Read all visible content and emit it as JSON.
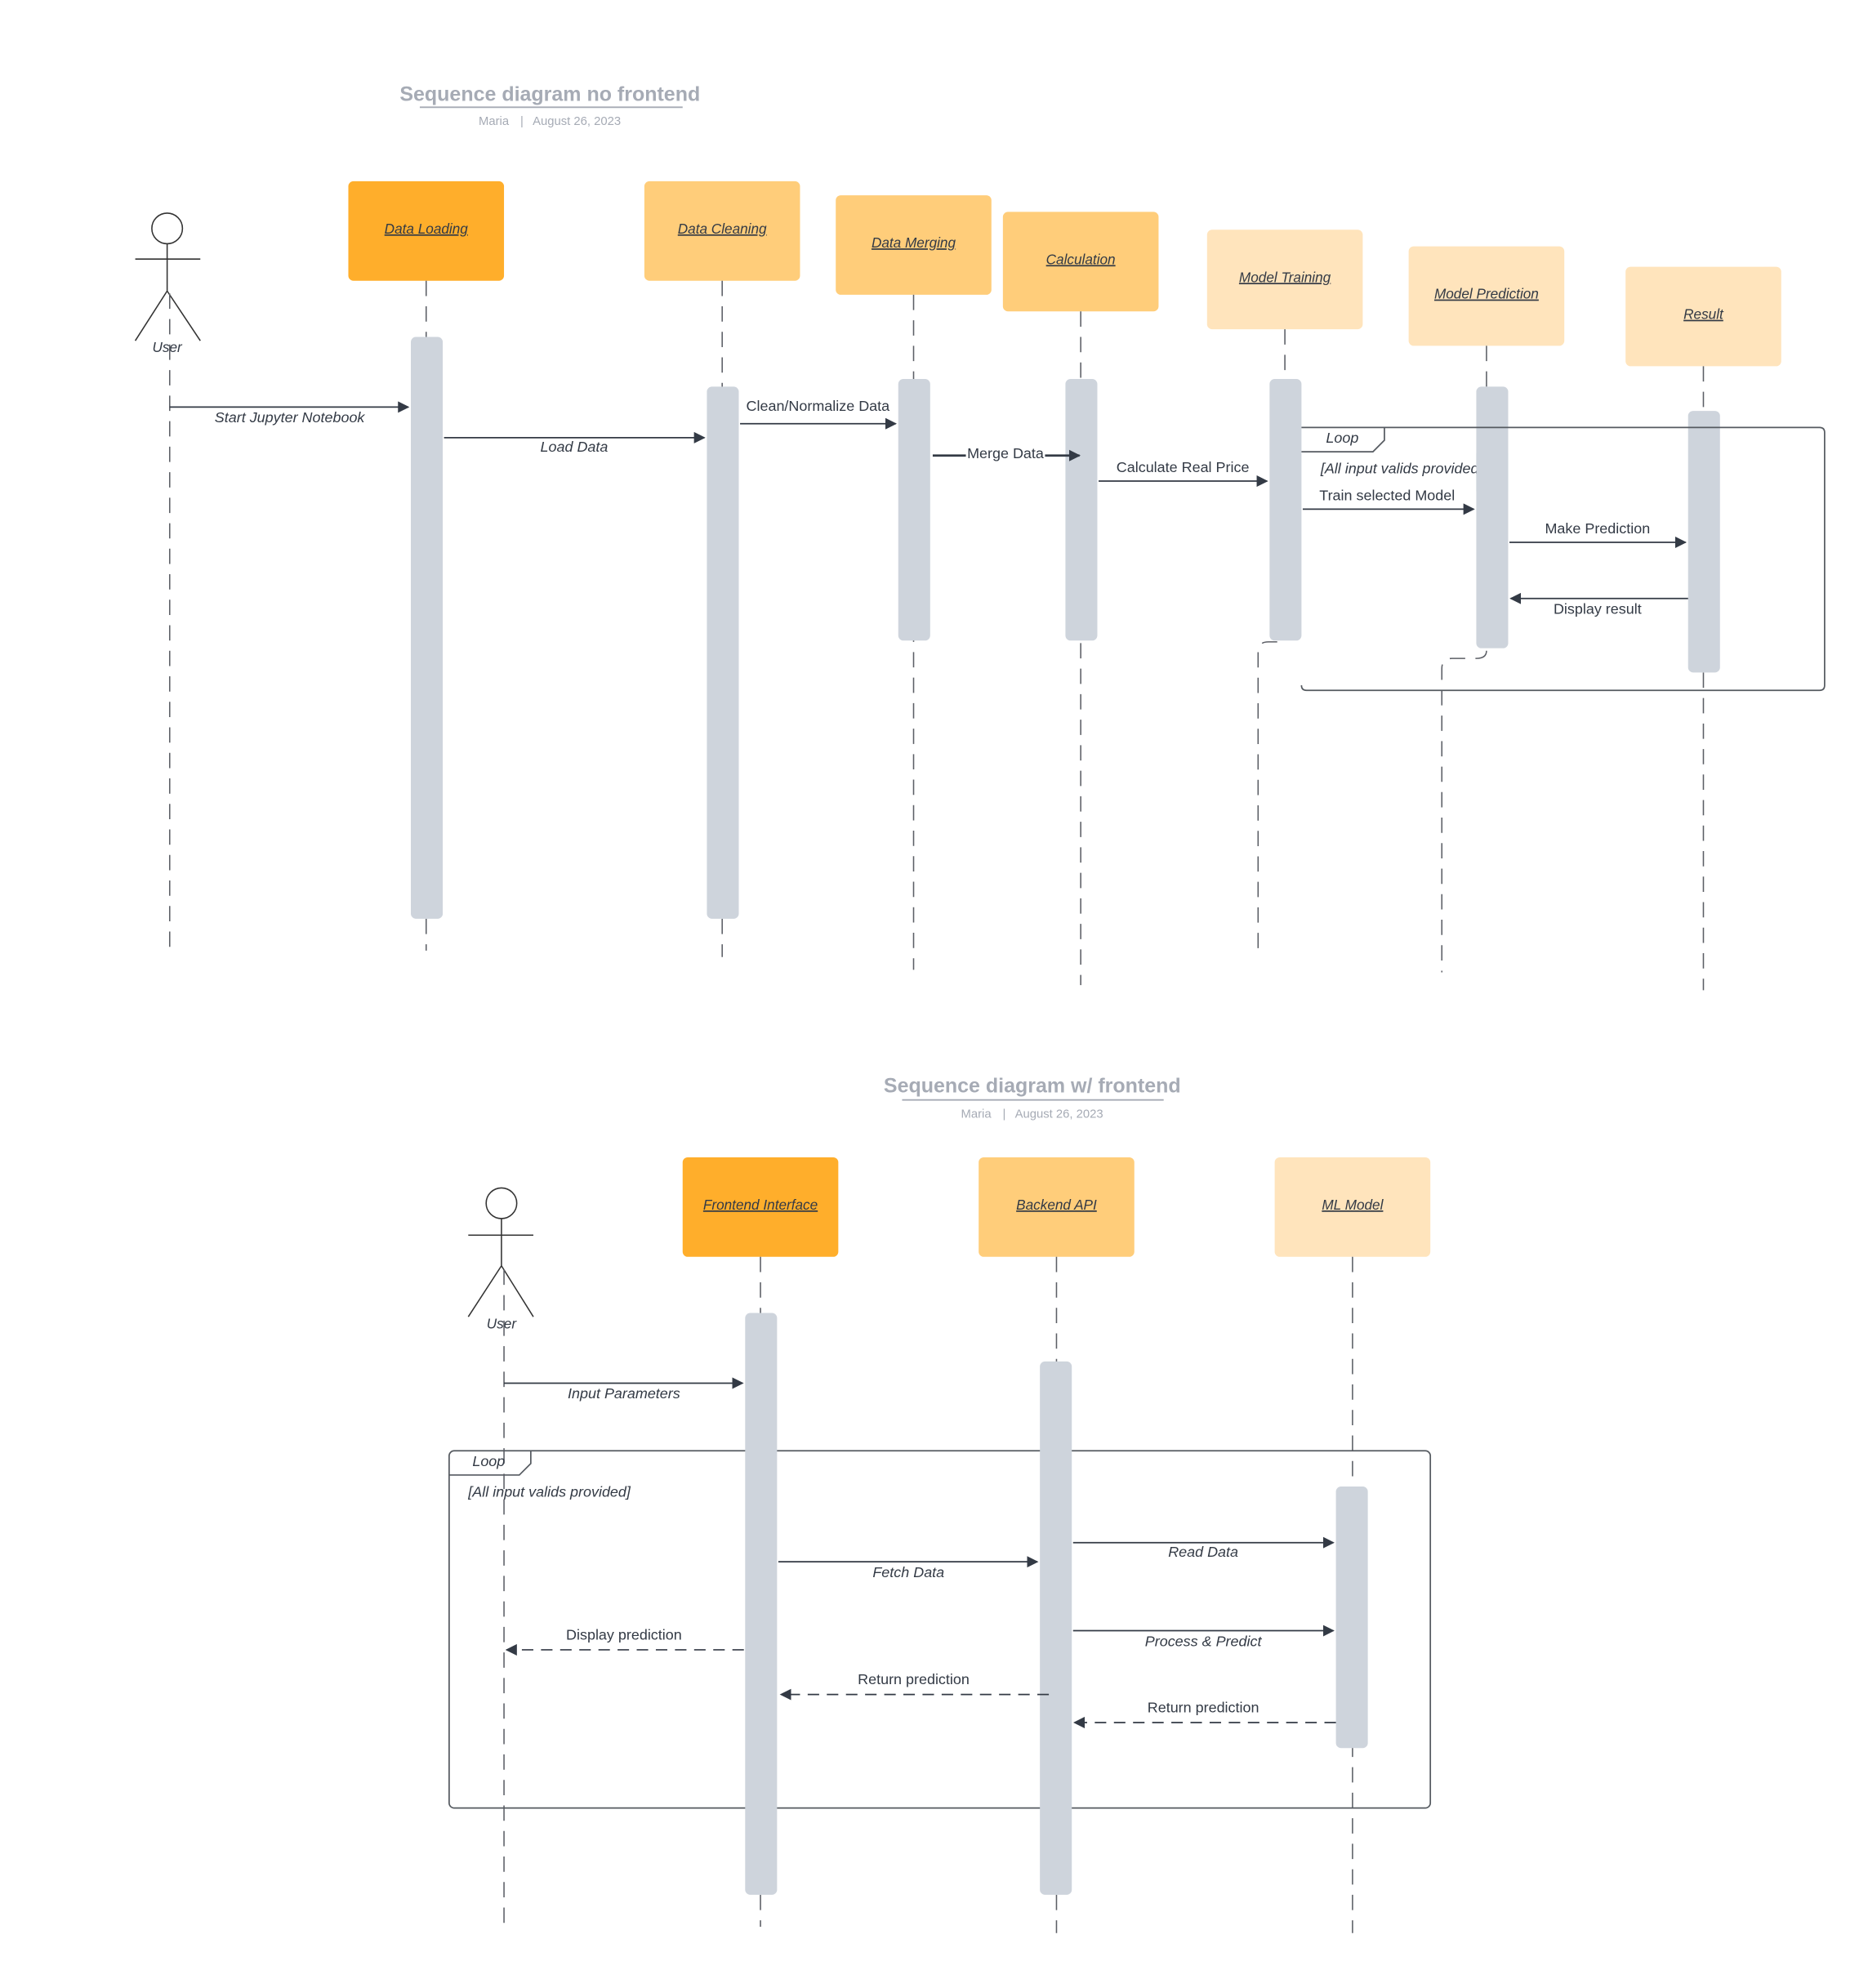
{
  "diagrams": [
    {
      "title": "Sequence diagram no frontend",
      "author": "Maria",
      "separator": "|",
      "date": "August 26, 2023",
      "actor": "User",
      "participants": [
        {
          "label": "Data Loading",
          "color": "#ffae2b"
        },
        {
          "label": "Data Cleaning",
          "color": "#ffcd7a"
        },
        {
          "label": "Data Merging",
          "color": "#ffcd7a"
        },
        {
          "label": "Calculation",
          "color": "#ffcd7a"
        },
        {
          "label": "Model Training",
          "color": "#ffe4bc"
        },
        {
          "label": "Model Prediction",
          "color": "#ffe4bc"
        },
        {
          "label": "Result",
          "color": "#ffe4bc"
        }
      ],
      "messages": [
        {
          "from": "User",
          "to": "Data Loading",
          "label": "Start Jupyter Notebook",
          "style": "solid"
        },
        {
          "from": "Data Loading",
          "to": "Data Cleaning",
          "label": "Load Data",
          "style": "solid"
        },
        {
          "from": "Data Cleaning",
          "to": "Data Merging",
          "label": "Clean/Normalize Data",
          "style": "solid"
        },
        {
          "from": "Data Merging",
          "to": "Calculation",
          "label": "Merge Data",
          "style": "solid"
        },
        {
          "from": "Calculation",
          "to": "Model Training",
          "label": "Calculate Real Price",
          "style": "solid"
        },
        {
          "from": "Model Training",
          "to": "Model Prediction",
          "label": "Train selected Model",
          "style": "solid"
        },
        {
          "from": "Model Prediction",
          "to": "Result",
          "label": "Make Prediction",
          "style": "solid"
        },
        {
          "from": "Result",
          "to": "Model Prediction",
          "label": "Display result",
          "style": "solid"
        }
      ],
      "loop": {
        "label": "Loop",
        "guard": "[All input valids provided]"
      }
    },
    {
      "title": "Sequence diagram w/ frontend",
      "author": "Maria",
      "separator": "|",
      "date": "August 26, 2023",
      "actor": "User",
      "participants": [
        {
          "label": "Frontend Interface",
          "color": "#ffae2b"
        },
        {
          "label": "Backend API",
          "color": "#ffcd7a"
        },
        {
          "label": "ML Model",
          "color": "#ffe4bc"
        }
      ],
      "messages": [
        {
          "from": "User",
          "to": "Frontend Interface",
          "label": "Input Parameters",
          "style": "solid"
        },
        {
          "from": "Backend API",
          "to": "ML Model",
          "label": "Read Data",
          "style": "solid"
        },
        {
          "from": "Frontend Interface",
          "to": "Backend API",
          "label": "Fetch Data",
          "style": "solid"
        },
        {
          "from": "Frontend Interface",
          "to": "User",
          "label": "Display prediction",
          "style": "dashed"
        },
        {
          "from": "Backend API",
          "to": "ML Model",
          "label": "Process & Predict",
          "style": "solid"
        },
        {
          "from": "Backend API",
          "to": "Frontend Interface",
          "label": "Return prediction",
          "style": "dashed"
        },
        {
          "from": "ML Model",
          "to": "Backend API",
          "label": "Return prediction",
          "style": "dashed"
        }
      ],
      "loop": {
        "label": "Loop",
        "guard": "[All input valids provided]"
      }
    }
  ]
}
